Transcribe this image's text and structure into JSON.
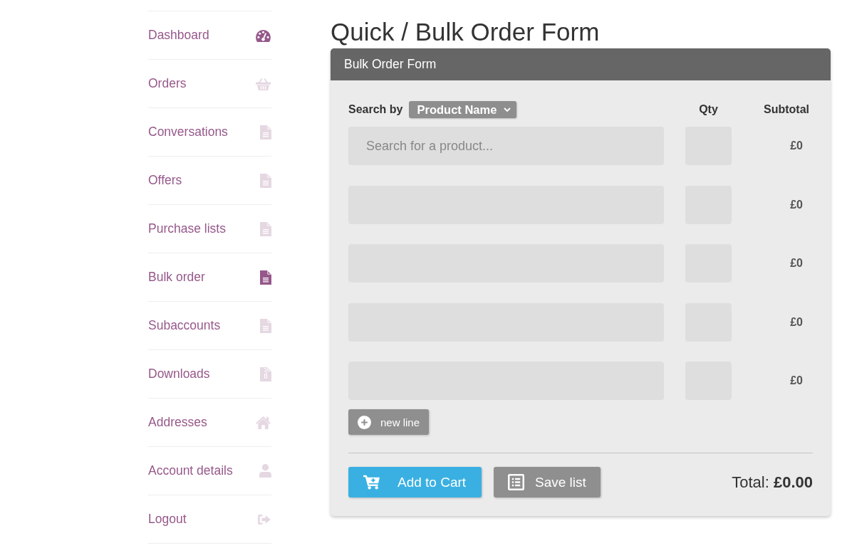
{
  "sidebar": {
    "items": [
      {
        "label": "Dashboard",
        "selected": true
      },
      {
        "label": "Orders",
        "selected": false
      },
      {
        "label": "Conversations",
        "selected": false
      },
      {
        "label": "Offers",
        "selected": false
      },
      {
        "label": "Purchase lists",
        "selected": false
      },
      {
        "label": "Bulk order",
        "selected": true
      },
      {
        "label": "Subaccounts",
        "selected": false
      },
      {
        "label": "Downloads",
        "selected": false
      },
      {
        "label": "Addresses",
        "selected": false
      },
      {
        "label": "Account details",
        "selected": false
      },
      {
        "label": "Logout",
        "selected": false
      }
    ]
  },
  "page_title": "Quick / Bulk Order Form",
  "form": {
    "title": "Bulk Order Form",
    "search_by_label": "Search by",
    "search_by_value": "Product Name",
    "columns": {
      "qty": "Qty",
      "subtotal": "Subtotal"
    },
    "rows": [
      {
        "placeholder": "Search for a product...",
        "subtotal": "£0"
      },
      {
        "subtotal": "£0"
      },
      {
        "subtotal": "£0"
      },
      {
        "subtotal": "£0"
      },
      {
        "subtotal": "£0"
      }
    ],
    "new_line_button": "new line",
    "add_to_cart_button": "Add to Cart",
    "save_list_button": "Save list",
    "total": "Total: **£0.00**"
  }
}
